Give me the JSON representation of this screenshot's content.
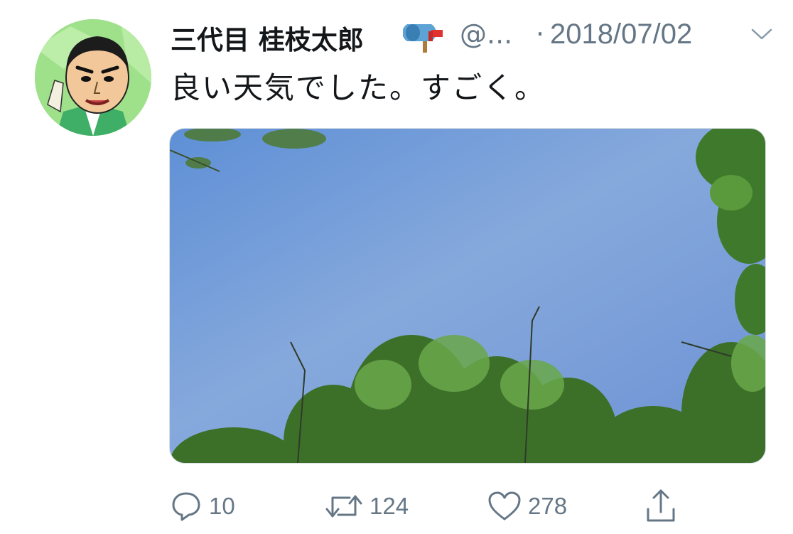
{
  "tweet": {
    "display_name": "三代目 桂枝太郎",
    "handle": "@...",
    "separator": "·",
    "date": "2018/07/02",
    "text": "良い天気でした。すごく。"
  },
  "actions": {
    "reply_count": "10",
    "retweet_count": "124",
    "like_count": "278"
  },
  "icons": {
    "name_emoji": "mailbox-icon",
    "menu": "chevron-down-icon",
    "reply": "reply-icon",
    "retweet": "retweet-icon",
    "like": "heart-icon",
    "share": "share-icon"
  },
  "colors": {
    "text_primary": "#14171a",
    "text_secondary": "#657786",
    "sky": "#6f97d8",
    "foliage": "#3f7a2c",
    "avatar_bg": "#9fe08a"
  }
}
